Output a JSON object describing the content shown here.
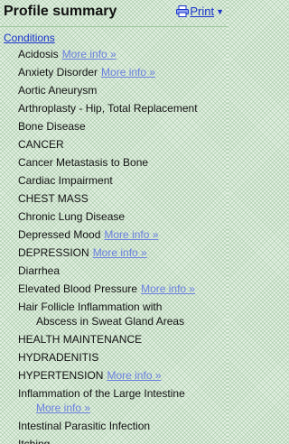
{
  "header": {
    "title": "Profile summary",
    "print_label": "Print",
    "print_icon": "printer-icon",
    "caret_icon": "caret-down-icon"
  },
  "section": {
    "label": "Conditions"
  },
  "more_info_label": "More info »",
  "colors": {
    "link": "#1a33cc",
    "more_info_link": "#6b7fe0",
    "background": "#e6f2e6"
  },
  "conditions": [
    {
      "name": "Acidosis",
      "more_info": true
    },
    {
      "name": "Anxiety Disorder",
      "more_info": true
    },
    {
      "name": "Aortic Aneurysm",
      "more_info": false
    },
    {
      "name": "Arthroplasty - Hip, Total Replacement",
      "more_info": false
    },
    {
      "name": "Bone Disease",
      "more_info": false
    },
    {
      "name": "CANCER",
      "more_info": false
    },
    {
      "name": "Cancer Metastasis to Bone",
      "more_info": false
    },
    {
      "name": "Cardiac Impairment",
      "more_info": false
    },
    {
      "name": "CHEST MASS",
      "more_info": false
    },
    {
      "name": "Chronic Lung Disease",
      "more_info": false
    },
    {
      "name": "Depressed Mood",
      "more_info": true
    },
    {
      "name": "DEPRESSION",
      "more_info": true
    },
    {
      "name": "Diarrhea",
      "more_info": false
    },
    {
      "name": "Elevated Blood Pressure",
      "more_info": true
    },
    {
      "name": "Hair Follicle Inflammation with",
      "name_line2": "Abscess in Sweat Gland Areas",
      "more_info": false
    },
    {
      "name": "HEALTH MAINTENANCE",
      "more_info": false
    },
    {
      "name": "HYDRADENITIS",
      "more_info": false
    },
    {
      "name": "HYPERTENSION",
      "more_info": true
    },
    {
      "name": "Inflammation of the Large Intestine",
      "more_info": true,
      "more_info_block": true
    },
    {
      "name": "Intestinal Parasitic Infection",
      "more_info": false
    },
    {
      "name": "Itching",
      "more_info": false
    }
  ]
}
